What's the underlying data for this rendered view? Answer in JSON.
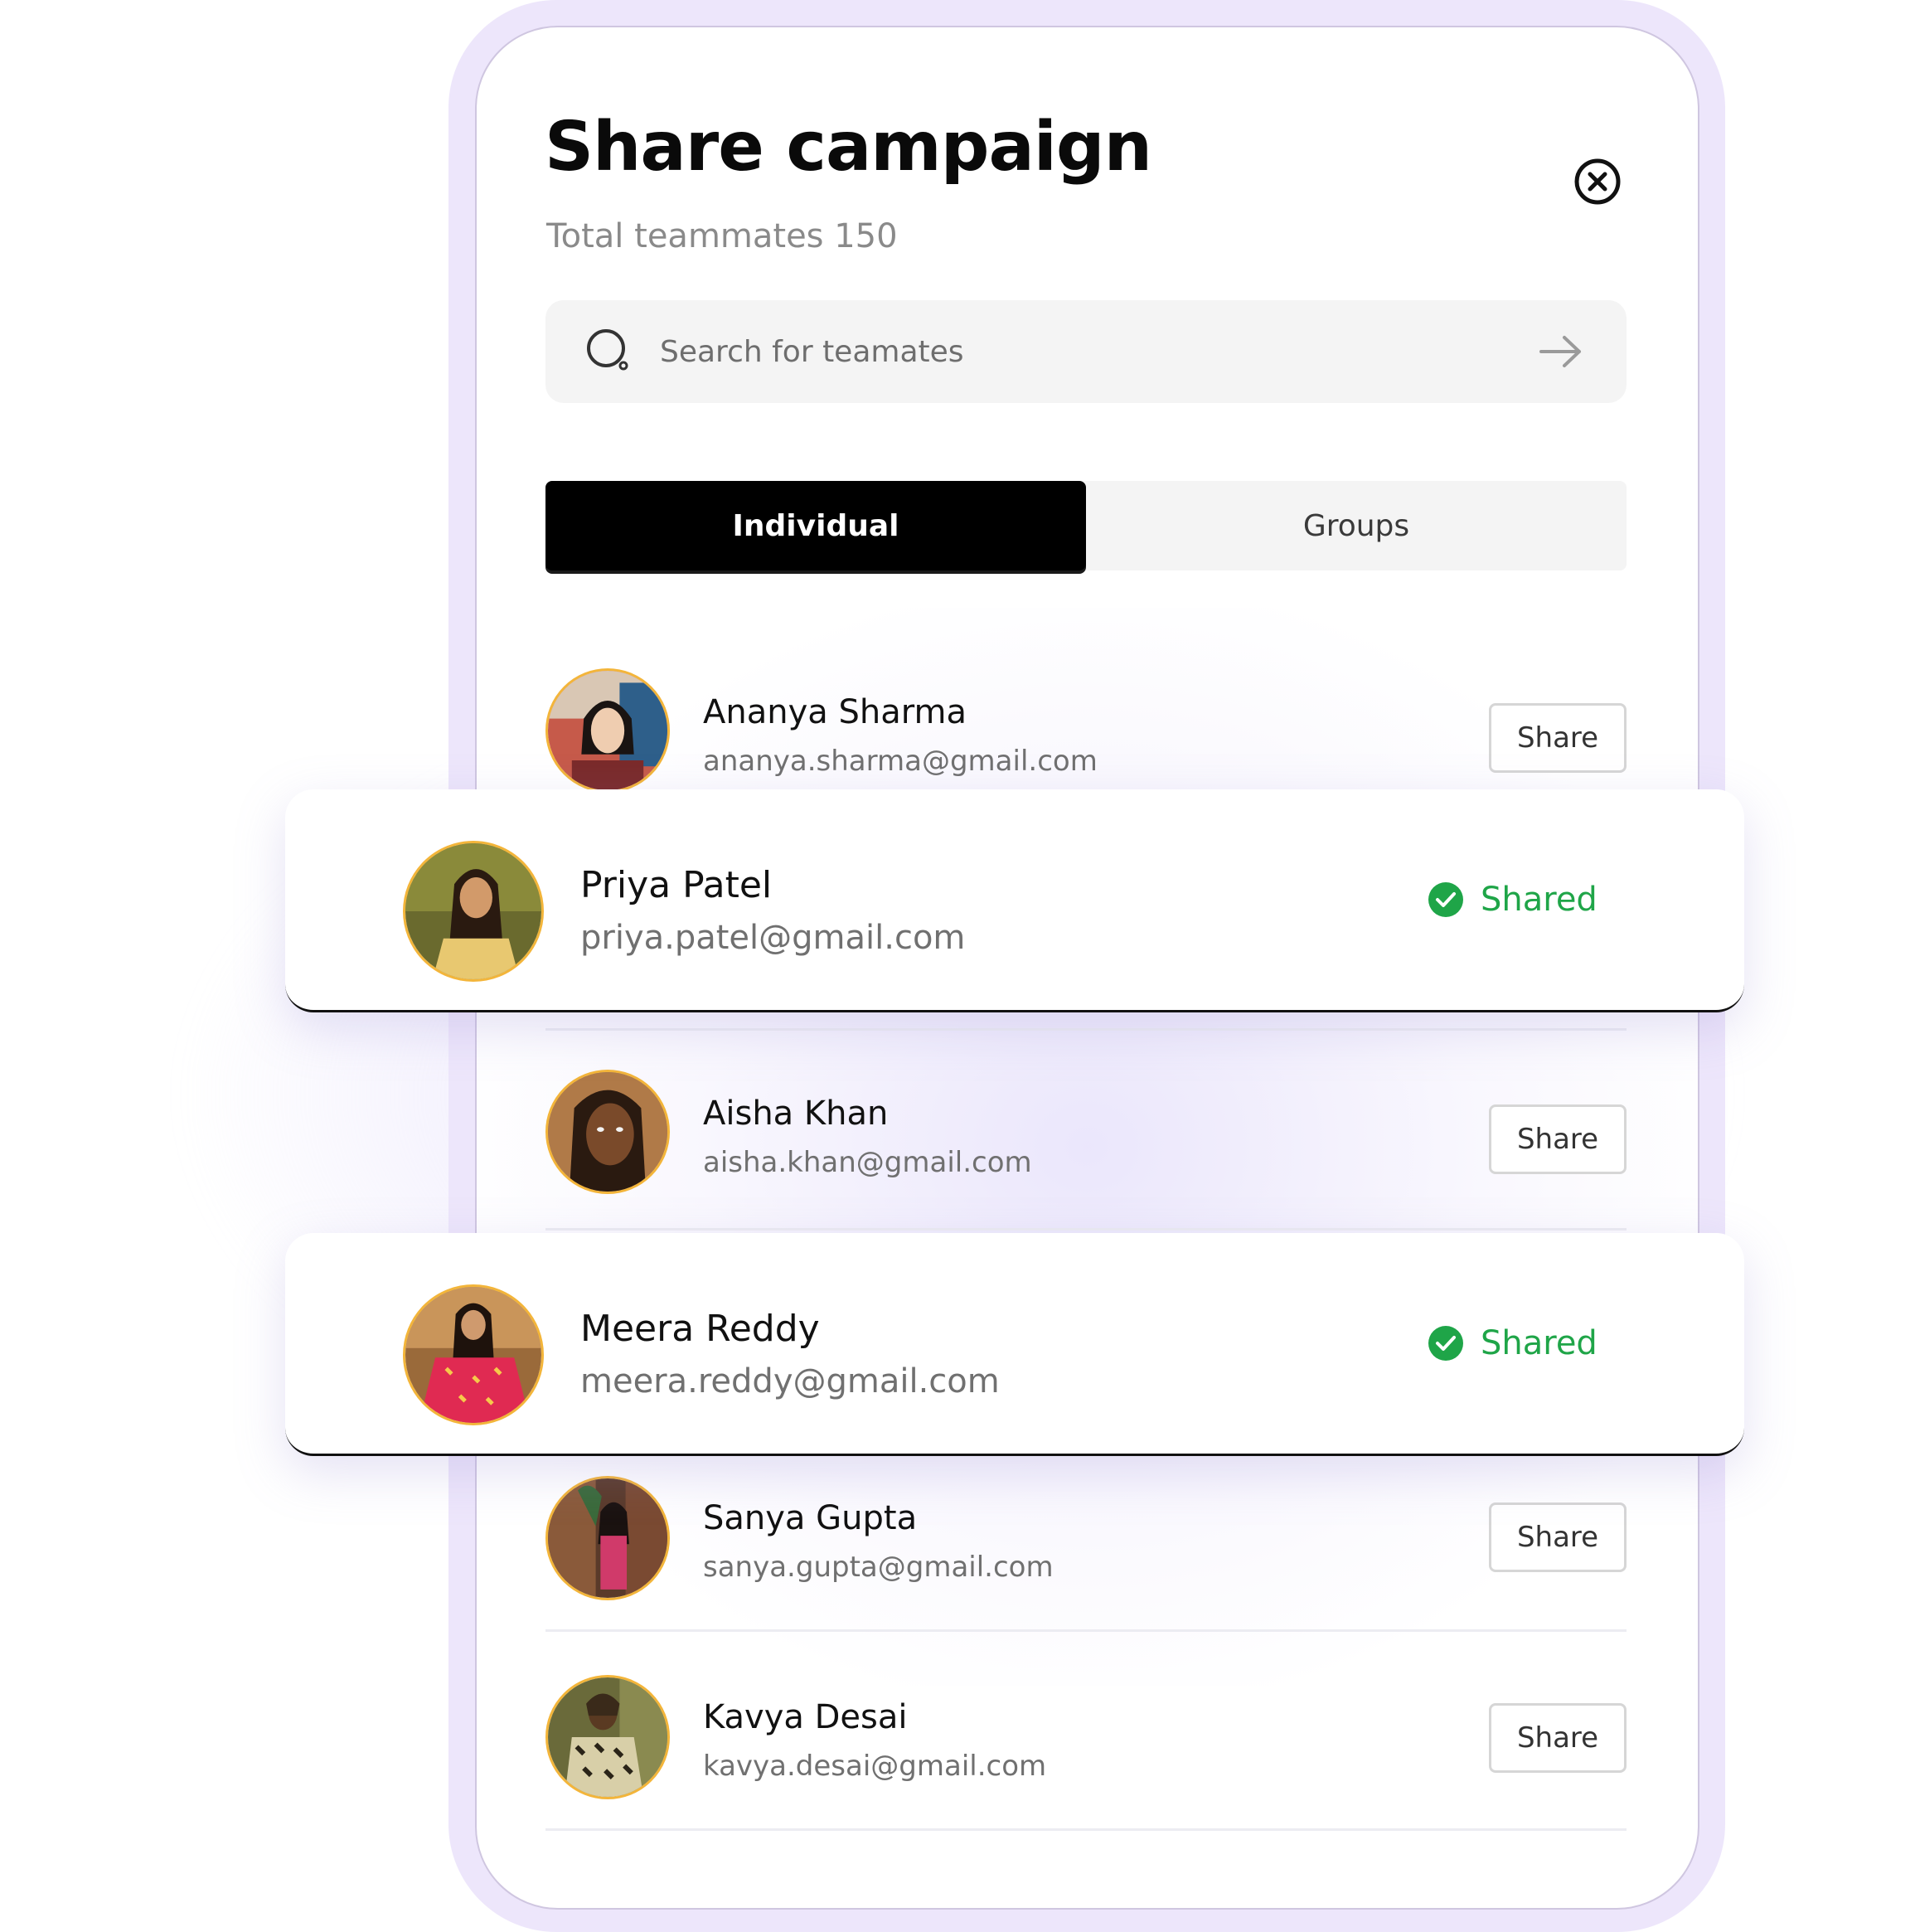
{
  "dialog": {
    "title": "Share campaign",
    "subtitle": "Total teammates 150"
  },
  "search": {
    "placeholder": "Search for teamates",
    "value": ""
  },
  "tabs": [
    {
      "label": "Individual",
      "active": true
    },
    {
      "label": "Groups",
      "active": false
    }
  ],
  "teammates": [
    {
      "name": "Ananya Sharma",
      "email": "ananya.sharma@gmail.com",
      "action": "Share",
      "status": "share"
    },
    {
      "name": "Priya Patel",
      "email": "priya.patel@gmail.com",
      "action": "Shared",
      "status": "shared"
    },
    {
      "name": "Aisha Khan",
      "email": "aisha.khan@gmail.com",
      "action": "Share",
      "status": "share"
    },
    {
      "name": "Meera Reddy",
      "email": "meera.reddy@gmail.com",
      "action": "Shared",
      "status": "shared"
    },
    {
      "name": "Sanya Gupta",
      "email": "sanya.gupta@gmail.com",
      "action": "Share",
      "status": "share"
    },
    {
      "name": "Kavya Desai",
      "email": "kavya.desai@gmail.com",
      "action": "Share",
      "status": "share"
    }
  ],
  "icons": {
    "close": "close-circle-icon",
    "search": "search-icon",
    "submit": "arrow-right-icon",
    "shared": "check-circle-icon"
  },
  "colors": {
    "accent_shared": "#1fa548",
    "tab_active_bg": "#000000",
    "frame": "#ede6fb",
    "avatar_ring": "#f3b53a"
  }
}
